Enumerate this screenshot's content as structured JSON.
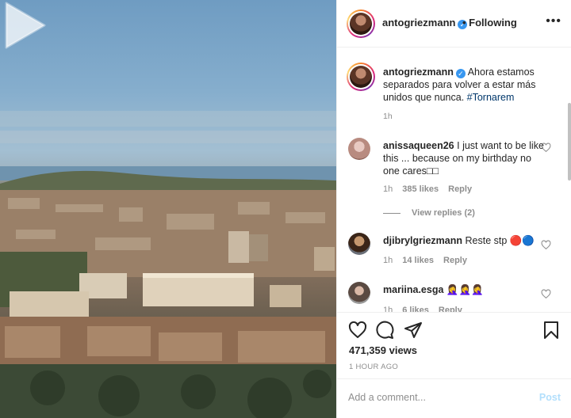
{
  "post": {
    "username": "antogriezmann",
    "follow_status": "• Following",
    "more_icon": "more-horizontal-icon",
    "verified_icon": "verified-badge-icon"
  },
  "caption": {
    "username": "antogriezmann",
    "text": "Ahora estamos separados para volver a estar más unidos que nunca.",
    "hashtag": "#Tornarem",
    "time": "1h"
  },
  "comments": [
    {
      "username": "anissaqueen26",
      "text": "I just want to be like this ... because on my birthday no one cares□□",
      "time": "1h",
      "likes": "385 likes",
      "reply": "Reply"
    },
    {
      "username": "djibrylgriezmann",
      "text": "Reste stp",
      "emoji": "🔴🔵",
      "time": "1h",
      "likes": "14 likes",
      "reply": "Reply"
    },
    {
      "username": "mariina.esga",
      "text": "",
      "emoji": "🤦‍♀️🤦‍♀️🤦‍♀️",
      "time": "1h",
      "likes": "6 likes",
      "reply": "Reply"
    }
  ],
  "view_replies": "View replies (2)",
  "stats": {
    "views": "471,359 views",
    "ago": "1 HOUR AGO"
  },
  "add_comment": {
    "placeholder": "Add a comment...",
    "post_label": "Post"
  },
  "icons": {
    "like": "heart-icon",
    "comment": "comment-icon",
    "share": "send-icon",
    "save": "bookmark-icon",
    "play": "play-icon"
  },
  "colors": {
    "link": "#00376b",
    "post_disabled": "#b2dffc",
    "verified": "#3897f0"
  }
}
